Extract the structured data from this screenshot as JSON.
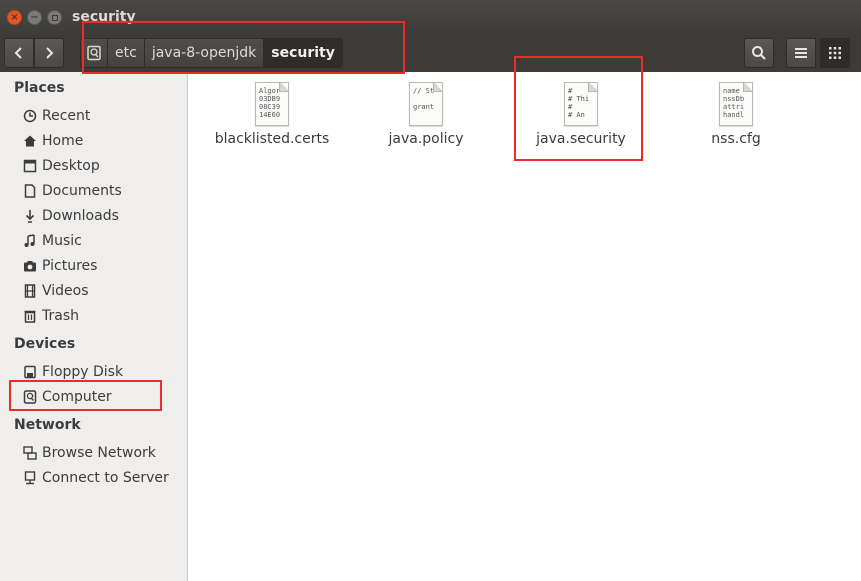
{
  "window": {
    "title": "security"
  },
  "breadcrumb": {
    "items": [
      "etc",
      "java-8-openjdk",
      "security"
    ]
  },
  "sidebar": {
    "places_label": "Places",
    "places": [
      {
        "label": "Recent",
        "icon": "clock-icon"
      },
      {
        "label": "Home",
        "icon": "home-icon"
      },
      {
        "label": "Desktop",
        "icon": "folder-icon"
      },
      {
        "label": "Documents",
        "icon": "document-icon"
      },
      {
        "label": "Downloads",
        "icon": "download-icon"
      },
      {
        "label": "Music",
        "icon": "music-icon"
      },
      {
        "label": "Pictures",
        "icon": "camera-icon"
      },
      {
        "label": "Videos",
        "icon": "film-icon"
      },
      {
        "label": "Trash",
        "icon": "trash-icon"
      }
    ],
    "devices_label": "Devices",
    "devices": [
      {
        "label": "Floppy Disk",
        "icon": "floppy-icon"
      },
      {
        "label": "Computer",
        "icon": "harddisk-icon"
      }
    ],
    "network_label": "Network",
    "network": [
      {
        "label": "Browse Network",
        "icon": "network-icon"
      },
      {
        "label": "Connect to Server",
        "icon": "server-icon"
      }
    ]
  },
  "files": [
    {
      "name": "blacklisted.certs",
      "preview": "Algor\n03DB9\n08C39\n14E60"
    },
    {
      "name": "java.policy",
      "preview": "// St\n\ngrant"
    },
    {
      "name": "java.security",
      "preview": "#\n# Thi\n#\n# An"
    },
    {
      "name": "nss.cfg",
      "preview": "name\nnssDb\nattri\nhandl"
    }
  ],
  "colors": {
    "close": "#e95420",
    "annotation": "#ee2b2b"
  }
}
